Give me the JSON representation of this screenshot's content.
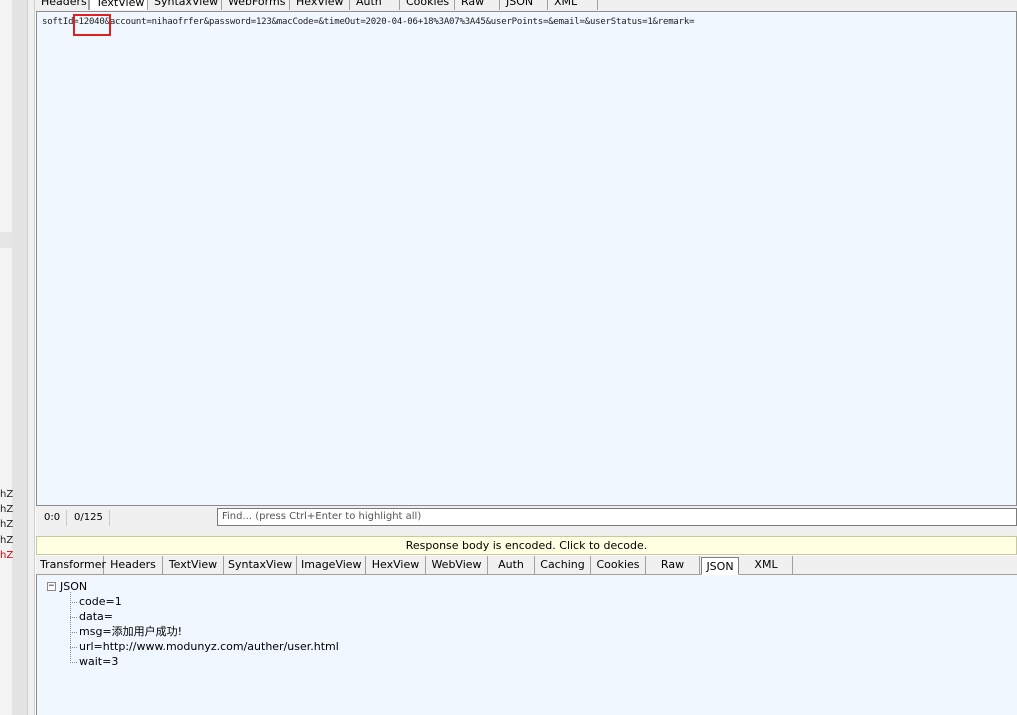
{
  "left_strip": {
    "labels": [
      {
        "text": "hZ",
        "color": "#222222"
      },
      {
        "text": "hZ",
        "color": "#222222"
      },
      {
        "text": "hZ",
        "color": "#222222"
      },
      {
        "text": "hZ",
        "color": "#222222"
      },
      {
        "text": "hZ",
        "color": "#d40000"
      }
    ]
  },
  "request": {
    "tabs": [
      {
        "label": "Headers",
        "active": false
      },
      {
        "label": "TextView",
        "active": true
      },
      {
        "label": "SyntaxView",
        "active": false
      },
      {
        "label": "WebForms",
        "active": false
      },
      {
        "label": "HexView",
        "active": false
      },
      {
        "label": "Auth",
        "active": false
      },
      {
        "label": "Cookies",
        "active": false
      },
      {
        "label": "Raw",
        "active": false
      },
      {
        "label": "JSON",
        "active": false
      },
      {
        "label": "XML",
        "active": false
      }
    ],
    "body_text": "softId=12040&account=nihaofrfer&password=123&macCode=&timeOut=2020-04-06+18%3A07%3A45&userPoints=&email=&userStatus=1&remark=",
    "highlight_color": "#e02020"
  },
  "status": {
    "cursor_pos": "0:0",
    "char_count": "0/125",
    "find_placeholder": "Find... (press Ctrl+Enter to highlight all)"
  },
  "response": {
    "banner_text": "Response body is encoded. Click to decode.",
    "banner_color": "#ffffe1",
    "tabs": [
      {
        "label": "Transformer",
        "active": false
      },
      {
        "label": "Headers",
        "active": false
      },
      {
        "label": "TextView",
        "active": false
      },
      {
        "label": "SyntaxView",
        "active": false
      },
      {
        "label": "ImageView",
        "active": false
      },
      {
        "label": "HexView",
        "active": false
      },
      {
        "label": "WebView",
        "active": false
      },
      {
        "label": "Auth",
        "active": false
      },
      {
        "label": "Caching",
        "active": false
      },
      {
        "label": "Cookies",
        "active": false
      },
      {
        "label": "Raw",
        "active": false
      },
      {
        "label": "JSON",
        "active": true
      },
      {
        "label": "XML",
        "active": false
      }
    ],
    "tree": {
      "toggle": "−",
      "root": "JSON",
      "children": [
        "code=1",
        "data=",
        "msg=添加用户成功!",
        "url=http://www.modunyz.com/auther/user.html",
        "wait=3"
      ]
    }
  },
  "background_color": "#f0f7ff"
}
